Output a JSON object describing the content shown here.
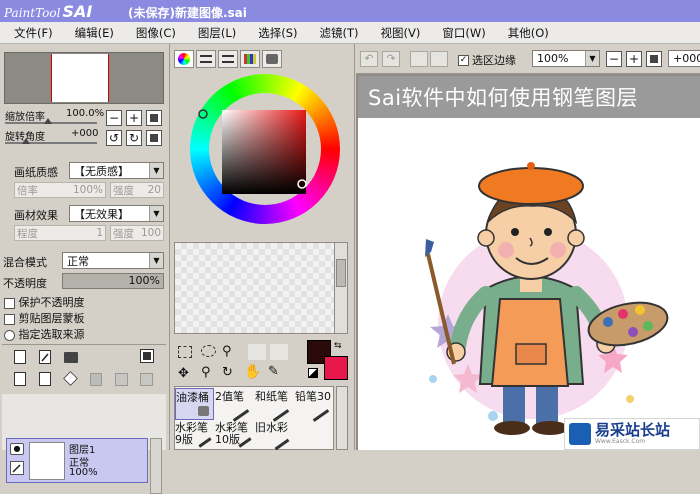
{
  "app": {
    "logo_prefix": "PaintTool",
    "logo_main": "SAI",
    "document_title": "(未保存)新建图像.sai"
  },
  "menu": [
    "文件(F)",
    "编辑(E)",
    "图像(C)",
    "图层(L)",
    "选择(S)",
    "滤镜(T)",
    "视图(V)",
    "窗口(W)",
    "其他(O)"
  ],
  "navigator": {
    "zoom_label": "缩放倍率",
    "zoom_value": "100.0%",
    "rotate_label": "旋转角度",
    "rotate_value": "+000"
  },
  "paper": {
    "texture_label": "画纸质感",
    "texture_value": "【无质感】",
    "texture_scale_label": "倍率",
    "texture_scale_value": "100%",
    "texture_strength_label": "强度",
    "texture_strength_value": "20",
    "effect_label": "画材效果",
    "effect_value": "【无效果】",
    "effect_degree_label": "程度",
    "effect_degree_value": "1",
    "effect_strength_label": "强度",
    "effect_strength_value": "100"
  },
  "layer_props": {
    "blend_label": "混合模式",
    "blend_value": "正常",
    "opacity_label": "不透明度",
    "opacity_value": "100%",
    "preserve_opacity": "保护不透明度",
    "clipping": "剪贴图层蒙板",
    "selection_source": "指定选取来源"
  },
  "layers": [
    {
      "name": "图层1",
      "mode": "正常",
      "opacity": "100%"
    }
  ],
  "brushes": {
    "row1": [
      "油漆桶",
      "2值笔",
      "和纸笔",
      "铅笔30"
    ],
    "row2": [
      "水彩笔",
      "水彩笔",
      "旧水彩"
    ],
    "row2_sub": [
      "9版",
      "10版",
      ""
    ]
  },
  "canvas_toolbar": {
    "selection_edge_label": "选区边缘",
    "selection_edge_checked": true,
    "zoom_value": "100%",
    "rotate_value": "+000"
  },
  "colors": {
    "title_bar": "#8a8ae0",
    "primary_color": "#2b0a0a",
    "secondary_color": "#e8174c",
    "banner_bg": "#9a9a9a"
  },
  "canvas": {
    "banner_text": "Sai软件中如何使用钢笔图层"
  },
  "watermark": {
    "text": "易采站长站",
    "subtext": "Www.Easck.Com"
  }
}
